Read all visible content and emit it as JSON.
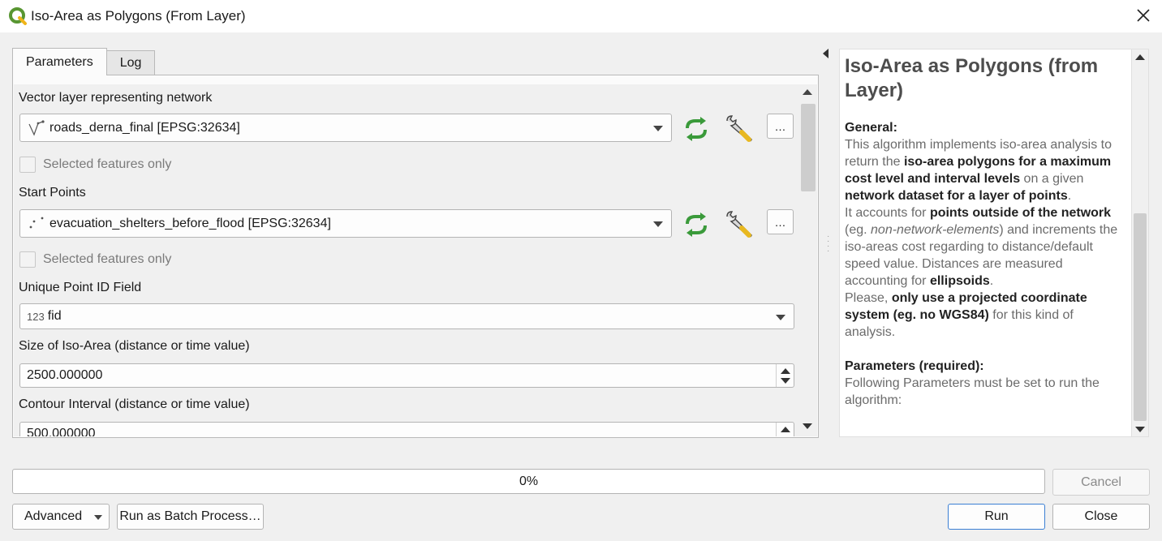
{
  "window": {
    "title": "Iso-Area as Polygons (From Layer)",
    "app_icon": "qgis-icon",
    "close_icon": "close-icon"
  },
  "tabs": [
    {
      "label": "Parameters",
      "active": true
    },
    {
      "label": "Log",
      "active": false
    }
  ],
  "params": {
    "network_label": "Vector layer representing network",
    "network_value": "roads_derna_final [EPSG:32634]",
    "network_icon": "line-layer-icon",
    "selected_only_1": "Selected features only",
    "start_points_label": "Start Points",
    "start_points_value": "evacuation_shelters_before_flood [EPSG:32634]",
    "start_points_icon": "point-layer-icon",
    "selected_only_2": "Selected features only",
    "unique_id_label": "Unique Point ID Field",
    "unique_id_type": "123",
    "unique_id_value": "fid",
    "size_label": "Size of Iso-Area (distance or time value)",
    "size_value": "2500.000000",
    "interval_label": "Contour Interval (distance or time value)",
    "interval_value": "500.000000",
    "dots_label": "…"
  },
  "help": {
    "title": "Iso-Area as Polygons (from Layer)",
    "general_heading": "General:",
    "p1_a": "This algorithm implements iso-area analysis to return the ",
    "p1_b": "iso-area polygons for a maximum cost level and interval levels",
    "p1_c": " on a given ",
    "p1_d": "network dataset for a layer of points",
    "p1_e": ".",
    "p2_a": "It accounts for ",
    "p2_b": "points outside of the network",
    "p2_c": " (eg. ",
    "p2_d": "non-network-elements",
    "p2_e": ") and increments the iso-areas cost regarding to distance/default speed value. Distances are measured accounting for ",
    "p2_f": "ellipsoids",
    "p2_g": ".",
    "p3_a": "Please, ",
    "p3_b": "only use a projected coordinate system (eg. no WGS84)",
    "p3_c": " for this kind of analysis.",
    "params_heading": "Parameters (required):",
    "params_text": "Following Parameters must be set to run the algorithm:"
  },
  "progress": {
    "text": "0%",
    "value": 0
  },
  "buttons": {
    "advanced": "Advanced",
    "batch": "Run as Batch Process…",
    "cancel": "Cancel",
    "run": "Run",
    "close": "Close"
  },
  "colors": {
    "accent": "#3b7fd4",
    "refresh_green": "#3a9a3a",
    "wrench_yellow": "#e8b820"
  }
}
